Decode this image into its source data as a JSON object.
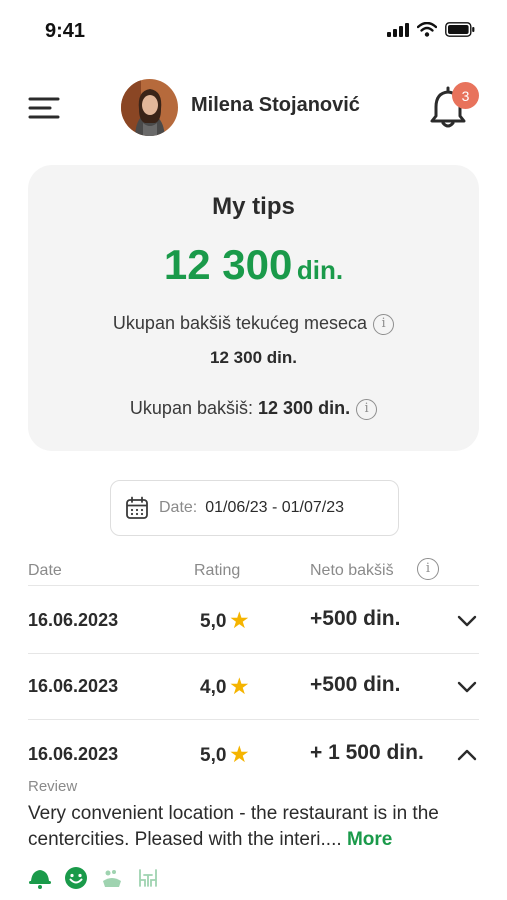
{
  "status_bar": {
    "time": "9:41"
  },
  "header": {
    "user_name": "Milena Stojanović",
    "notification_count": "3"
  },
  "tips_card": {
    "title": "My tips",
    "total_amount": "12 300",
    "total_unit": "din.",
    "month_label": "Ukupan bakšiš tekućeg meseca",
    "month_value": "12 300 din.",
    "all_label": "Ukupan bakšiš:",
    "all_value": "12 300 din."
  },
  "date_filter": {
    "label": "Date:",
    "value": "01/06/23 - 01/07/23"
  },
  "table": {
    "headers": {
      "date": "Date",
      "rating": "Rating",
      "neto": "Neto bakšiš"
    },
    "rows": [
      {
        "date": "16.06.2023",
        "rating": "5,0",
        "neto": "+500 din.",
        "expanded": false
      },
      {
        "date": "16.06.2023",
        "rating": "4,0",
        "neto": "+500 din.",
        "expanded": false
      },
      {
        "date": "16.06.2023",
        "rating": "5,0",
        "neto": "+ 1 500 din.",
        "expanded": true
      }
    ]
  },
  "review": {
    "label": "Review",
    "text": "Very convenient location - the restaurant is in the centercities. Pleased with the interi....",
    "more": "More"
  },
  "colors": {
    "accent_green": "#1a9a4a",
    "badge_red": "#e8735c",
    "star_yellow": "#f5b400",
    "card_bg": "#f4f4f4"
  },
  "icons": [
    "menu-icon",
    "bell-icon",
    "calendar-icon",
    "info-icon",
    "star-icon",
    "chevron-down-icon",
    "chevron-up-icon",
    "waiter-icon",
    "smile-icon",
    "food-icon",
    "interior-icon"
  ]
}
